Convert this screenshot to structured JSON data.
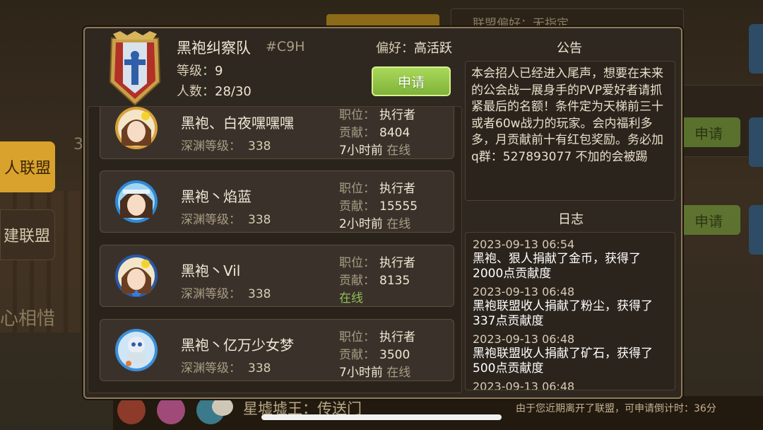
{
  "background": {
    "left_tabs": [
      "人联盟",
      "建联盟"
    ],
    "left_number": "3",
    "left_big_text": "心相惜",
    "top_field": "联盟偏好：无指定",
    "right_buttons": [
      "申请",
      "申请"
    ],
    "chat_text": "星墟墟王：传送门",
    "bottom_notice": "由于您近期离开了联盟，可申请倒计时：36分"
  },
  "guild": {
    "name": "黑袍纠察队",
    "tag": "#C9H",
    "level_label": "等级：",
    "level": "9",
    "members_label": "人数：",
    "members": "28/30",
    "preference_label": "偏好：",
    "preference": "高活跃",
    "apply_label": "申请"
  },
  "members": [
    {
      "name": "黑袍、白夜嘿嘿嘿",
      "abyss_label": "深渊等级：",
      "abyss": "338",
      "role_label": "职位：",
      "role": "执行者",
      "contrib_label": "贡献：",
      "contrib": "8404",
      "time": "7小时前",
      "status": "在线"
    },
    {
      "name": "黑袍丶焰蓝",
      "abyss_label": "深渊等级：",
      "abyss": "338",
      "role_label": "职位：",
      "role": "执行者",
      "contrib_label": "贡献：",
      "contrib": "15555",
      "time": "2小时前",
      "status": "在线"
    },
    {
      "name": "黑袍丶Vil",
      "abyss_label": "深渊等级：",
      "abyss": "338",
      "role_label": "职位：",
      "role": "执行者",
      "contrib_label": "贡献：",
      "contrib": "8135",
      "time": "",
      "status": "在线"
    },
    {
      "name": "黑袍丶亿万少女梦",
      "abyss_label": "深渊等级：",
      "abyss": "338",
      "role_label": "职位：",
      "role": "执行者",
      "contrib_label": "贡献：",
      "contrib": "3500",
      "time": "7小时前",
      "status": "在线"
    }
  ],
  "announcement": {
    "title": "公告",
    "text": "本会招人已经进入尾声，想要在未来的公会战一展身手的PVP爱好者请抓紧最后的名额！条件定为天梯前三十或者60w战力的玩家。会内福利多多，月贡献前十有红包奖励。务必加q群：527893077 不加的会被踢"
  },
  "log": {
    "title": "日志",
    "entries": [
      {
        "time": "2023-09-13 06:54",
        "text": "黑袍、狠人捐献了金币，获得了2000点贡献度"
      },
      {
        "time": "2023-09-13 06:48",
        "text": "黑袍联盟收人捐献了粉尘，获得了337点贡献度"
      },
      {
        "time": "2023-09-13 06:48",
        "text": "黑袍联盟收人捐献了矿石，获得了500点贡献度"
      },
      {
        "time": "2023-09-13 06:48",
        "text": ""
      }
    ]
  }
}
